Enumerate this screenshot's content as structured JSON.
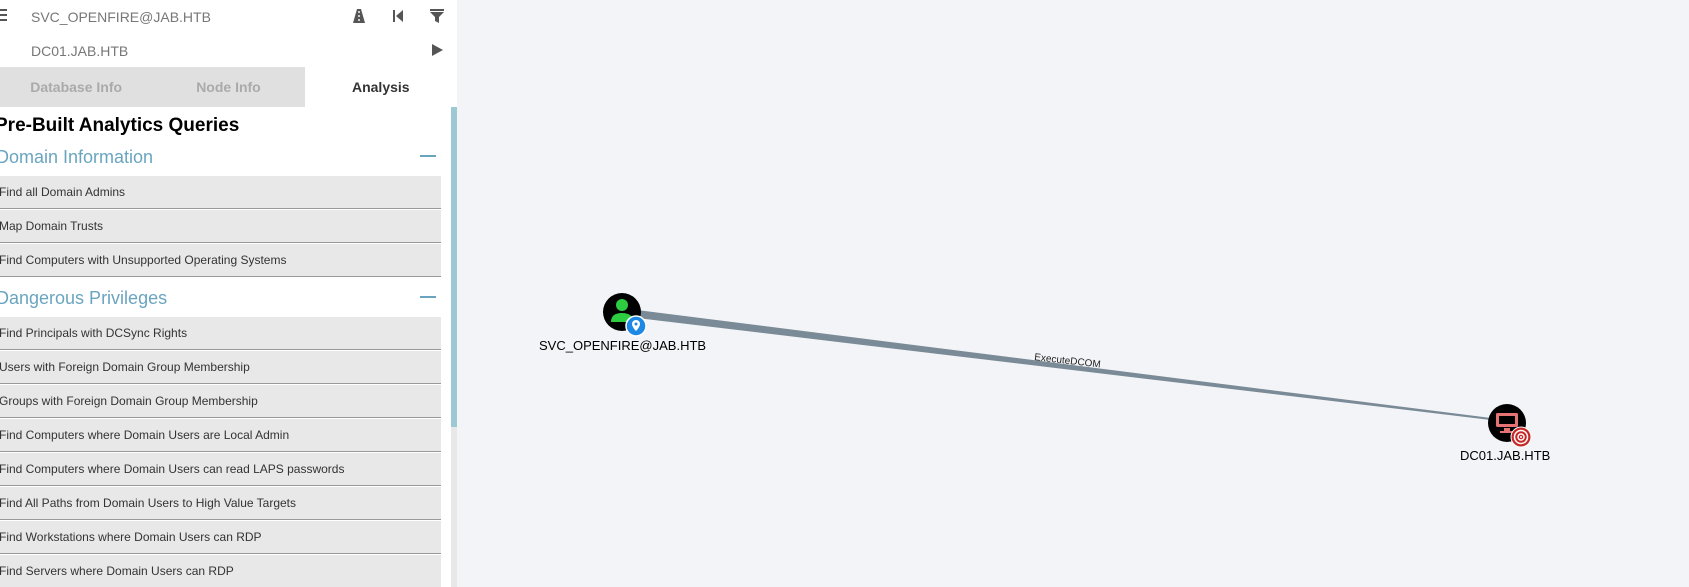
{
  "search": {
    "start_node": "SVC_OPENFIRE@JAB.HTB",
    "target_node": "DC01.JAB.HTB"
  },
  "tabs": [
    "Database Info",
    "Node Info",
    "Analysis"
  ],
  "active_tab": "Analysis",
  "panel": {
    "title": "Pre-Built Analytics Queries",
    "sections": [
      {
        "title": "Domain Information",
        "queries": [
          "Find all Domain Admins",
          "Map Domain Trusts",
          "Find Computers with Unsupported Operating Systems"
        ]
      },
      {
        "title": "Dangerous Privileges",
        "queries": [
          "Find Principals with DCSync Rights",
          "Users with Foreign Domain Group Membership",
          "Groups with Foreign Domain Group Membership",
          "Find Computers where Domain Users are Local Admin",
          "Find Computers where Domain Users can read LAPS passwords",
          "Find All Paths from Domain Users to High Value Targets",
          "Find Workstations where Domain Users can RDP",
          "Find Servers where Domain Users can RDP"
        ]
      }
    ]
  },
  "graph": {
    "nodes": [
      {
        "label": "SVC_OPENFIRE@JAB.HTB",
        "type": "user",
        "badge": "start-marker"
      },
      {
        "label": "DC01.JAB.HTB",
        "type": "computer",
        "badge": "target-marker"
      }
    ],
    "edge": {
      "label": "ExecuteDCOM"
    }
  },
  "colors": {
    "accent": "#6aa5c0",
    "user_icon": "#2ecc40",
    "computer_icon": "#e57373",
    "start_badge": "#1e88e5",
    "target_badge": "#c62828",
    "edge": "#7a8a96",
    "canvas": "#f2f4f7"
  }
}
